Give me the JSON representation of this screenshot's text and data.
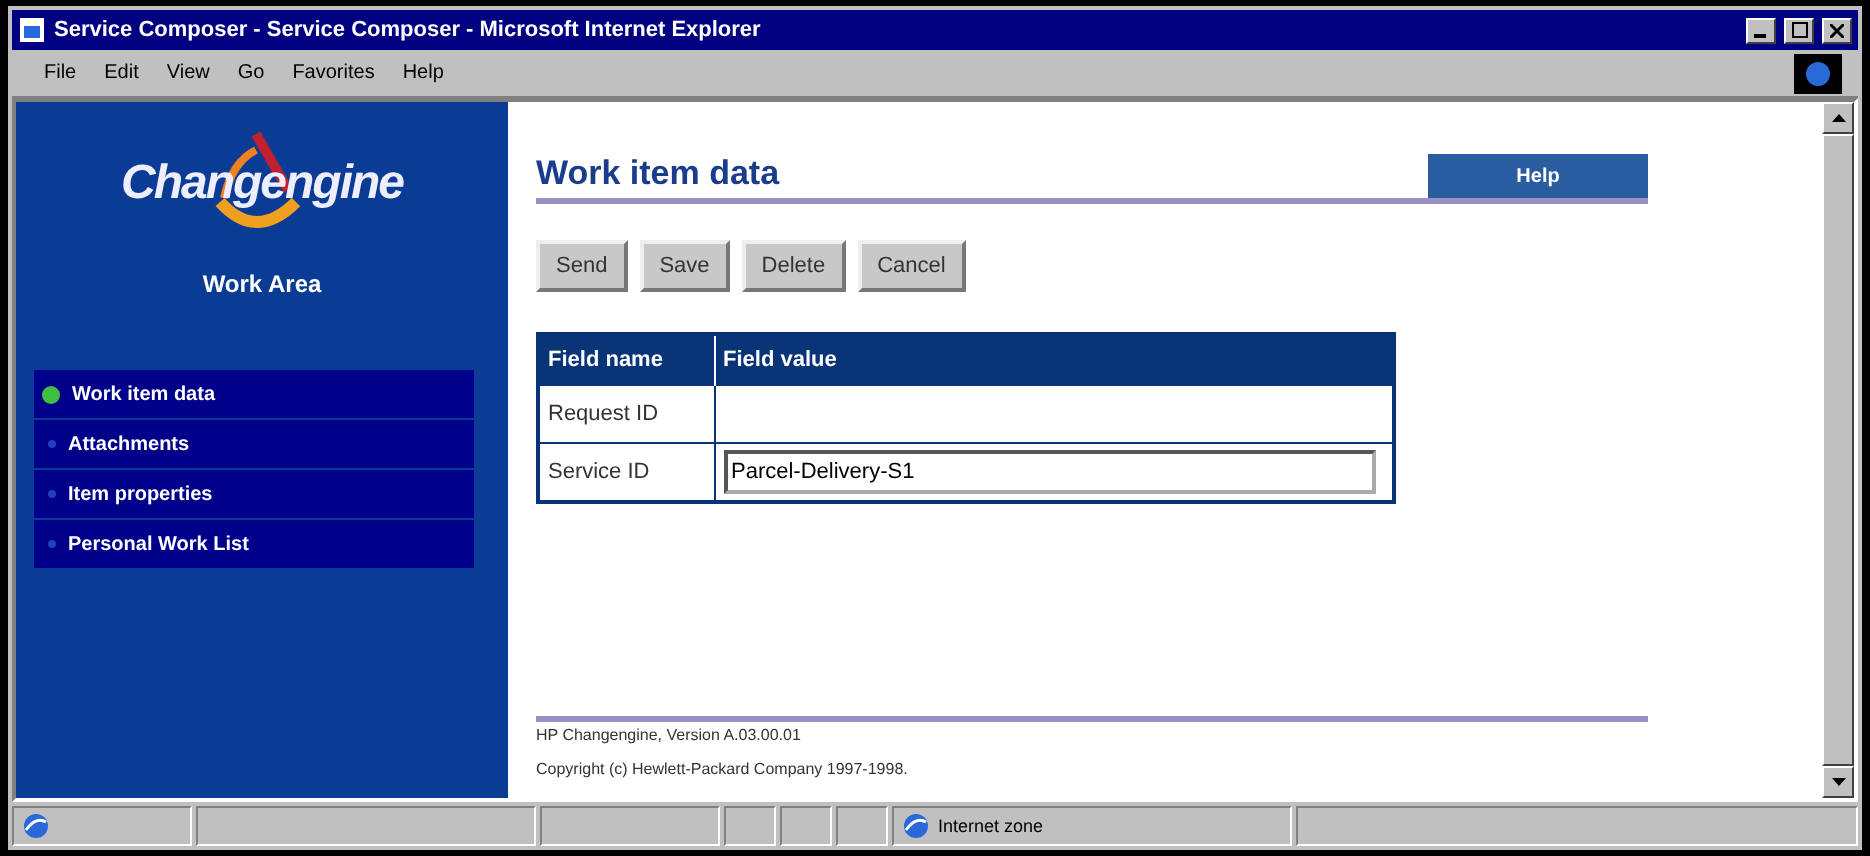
{
  "window": {
    "title": "Service Composer - Service Composer - Microsoft Internet Explorer"
  },
  "menu": [
    "File",
    "Edit",
    "View",
    "Go",
    "Favorites",
    "Help"
  ],
  "sidebar": {
    "logo": "Changengine",
    "heading": "Work Area",
    "items": [
      {
        "label": "Work item data",
        "selected": true
      },
      {
        "label": "Attachments",
        "selected": false
      },
      {
        "label": "Item properties",
        "selected": false
      },
      {
        "label": "Personal Work List",
        "selected": false
      }
    ]
  },
  "page": {
    "title": "Work item data",
    "help": "Help",
    "buttons": [
      "Send",
      "Save",
      "Delete",
      "Cancel"
    ],
    "table": {
      "columns": [
        "Field name",
        "Field value"
      ],
      "rows": [
        {
          "name": "Request ID",
          "kind": "empty"
        },
        {
          "name": "Service ID",
          "kind": "input",
          "value": "Parcel-Delivery-S1"
        }
      ]
    },
    "footer": [
      "HP Changengine, Version A.03.00.01",
      "Copyright (c) Hewlett-Packard Company 1997-1998."
    ]
  },
  "status_bar": {
    "zone": "Internet zone"
  }
}
